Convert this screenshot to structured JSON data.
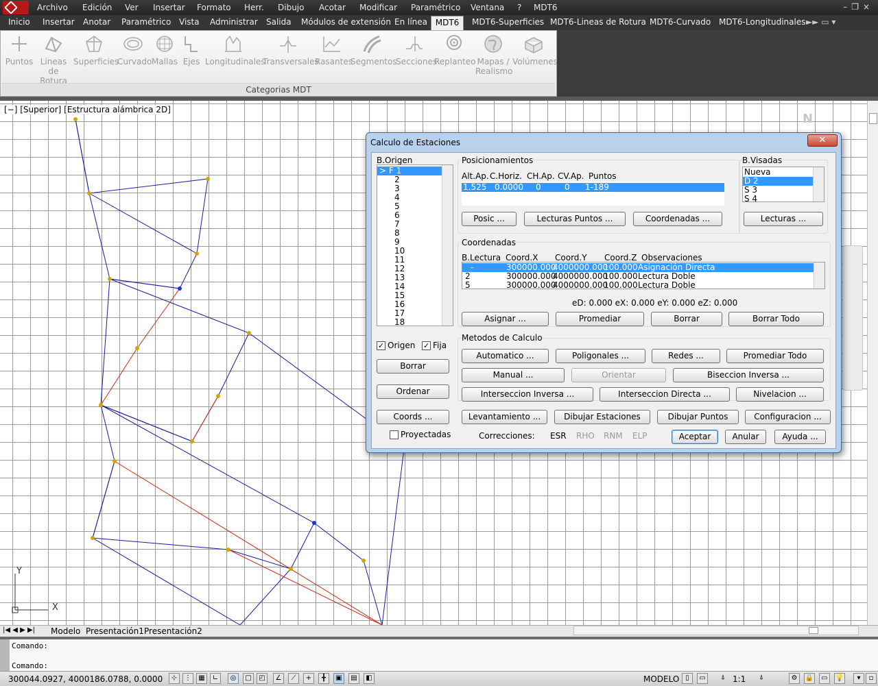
{
  "menu": {
    "items": [
      "Archivo",
      "Edición",
      "Ver",
      "Insertar",
      "Formato",
      "Herr.",
      "Dibujo",
      "Acotar",
      "Modificar",
      "Paramétrico",
      "Ventana",
      "?",
      "MDT6"
    ]
  },
  "ribbon_tabs": [
    "Inicio",
    "Insertar",
    "Anotar",
    "Paramétrico",
    "Vista",
    "Administrar",
    "Salida",
    "Módulos de extensión",
    "En línea",
    "MDT6",
    "MDT6-Superficies",
    "MDT6-Lineas de Rotura",
    "MDT6-Curvado",
    "MDT6-Longitudinales"
  ],
  "ribbon": {
    "buttons": [
      {
        "line1": "Puntos",
        "line2": "",
        "icon": "points-icon"
      },
      {
        "line1": "Lineas",
        "line2": "de Rotura",
        "icon": "breaklines-icon"
      },
      {
        "line1": "Superficies",
        "line2": "",
        "icon": "surfaces-icon"
      },
      {
        "line1": "Curvado",
        "line2": "",
        "icon": "contours-icon"
      },
      {
        "line1": "Mallas",
        "line2": "",
        "icon": "mesh-icon"
      },
      {
        "line1": "Ejes",
        "line2": "",
        "icon": "axes-icon"
      },
      {
        "line1": "Longitudinales",
        "line2": "",
        "icon": "longitudinal-icon"
      },
      {
        "line1": "Transversales",
        "line2": "",
        "icon": "cross-section-icon"
      },
      {
        "line1": "Rasantes",
        "line2": "",
        "icon": "grade-icon"
      },
      {
        "line1": "Segmentos",
        "line2": "",
        "icon": "segments-icon"
      },
      {
        "line1": "Secciones",
        "line2": "",
        "icon": "sections-icon"
      },
      {
        "line1": "Replanteo",
        "line2": "",
        "icon": "stakeout-icon"
      },
      {
        "line1": "Mapas /",
        "line2": "Realismo",
        "icon": "globe-icon"
      },
      {
        "line1": "Volúmenes",
        "line2": "",
        "icon": "volumes-icon"
      }
    ],
    "panel_label": "Categorias MDT"
  },
  "viewport": {
    "label": "[−] [Superior] [Estructura alámbrica 2D]",
    "north": "N",
    "ucs_x": "X",
    "ucs_y": "Y"
  },
  "layout_tabs": [
    "Modelo",
    "Presentación1",
    "Presentación2"
  ],
  "command": {
    "line1": "Comando:",
    "line2": "Comando:"
  },
  "status": {
    "coords": "300044.0927, 4000186.0788, 0.0000",
    "model": "MODELO",
    "scale": "1:1"
  },
  "dialog": {
    "title": "Calculo de Estaciones",
    "close": "✕",
    "b_origen": {
      "label": "B.Origen",
      "items": [
        "> F  1",
        "2",
        "3",
        "4",
        "5",
        "6",
        "7",
        "8",
        "9",
        "10",
        "11",
        "12",
        "13",
        "14",
        "15",
        "16",
        "17",
        "18"
      ],
      "selected": 0
    },
    "posicionamientos": {
      "label": "Posicionamientos",
      "headers": [
        "Alt.Ap.",
        "C.Horiz.",
        "CH.Ap.",
        "CV.Ap.",
        "Puntos"
      ],
      "row": [
        "1.525",
        "0.0000",
        "0",
        "0",
        "1-189"
      ],
      "buttons": [
        "Posic ...",
        "Lecturas Puntos ...",
        "Coordenadas ..."
      ]
    },
    "b_visadas": {
      "label": "B.Visadas",
      "items": [
        "Nueva",
        "D 2",
        "S 3",
        "S 4"
      ],
      "selected": 1,
      "button": "Lecturas ..."
    },
    "coordenadas": {
      "label": "Coordenadas",
      "headers": [
        "B.Lectura",
        "Coord.X",
        "Coord.Y",
        "Coord.Z",
        "Observaciones"
      ],
      "rows": [
        [
          "-",
          "300000.000",
          "4000000.000",
          "100.000",
          "Asignación Directa"
        ],
        [
          "2",
          "300000.000",
          "4000000.000",
          "100.000",
          "Lectura Doble"
        ],
        [
          "5",
          "300000.000",
          "4000000.000",
          "100.000",
          "Lectura Doble"
        ]
      ],
      "errors": "eD: 0.000  eX: 0.000  eY: 0.000  eZ: 0.000",
      "buttons": [
        "Asignar ...",
        "Promediar",
        "Borrar",
        "Borrar Todo"
      ]
    },
    "checks": {
      "origen": "Origen",
      "fija": "Fija",
      "check": "✓"
    },
    "left_buttons": [
      "Borrar",
      "Ordenar"
    ],
    "metodos": {
      "label": "Metodos de Calculo",
      "row1": [
        "Automatico ...",
        "Poligonales ...",
        "Redes ...",
        "Promediar Todo"
      ],
      "row2": [
        "Manual ...",
        "Orientar",
        "Biseccion Inversa ..."
      ],
      "row3": [
        "Interseccion Inversa ...",
        "Interseccion Directa ...",
        "Nivelacion ..."
      ]
    },
    "bottom_buttons": [
      "Coords ...",
      "Levantamiento ...",
      "Dibujar Estaciones",
      "Dibujar Puntos",
      "Configuracion ..."
    ],
    "proyectadas": "Proyectadas",
    "correcciones": {
      "label": "Correcciones:",
      "items": [
        {
          "name": "ESR",
          "enabled": true
        },
        {
          "name": "RHO",
          "enabled": false
        },
        {
          "name": "RNM",
          "enabled": false
        },
        {
          "name": "ELP",
          "enabled": false
        }
      ]
    },
    "actions": [
      "Aceptar",
      "Anular",
      "Ayuda ..."
    ]
  },
  "colors": {
    "traverse_line": "#1a1aa0",
    "red_line": "#cc2a12",
    "station_marker": "#d4a400"
  }
}
